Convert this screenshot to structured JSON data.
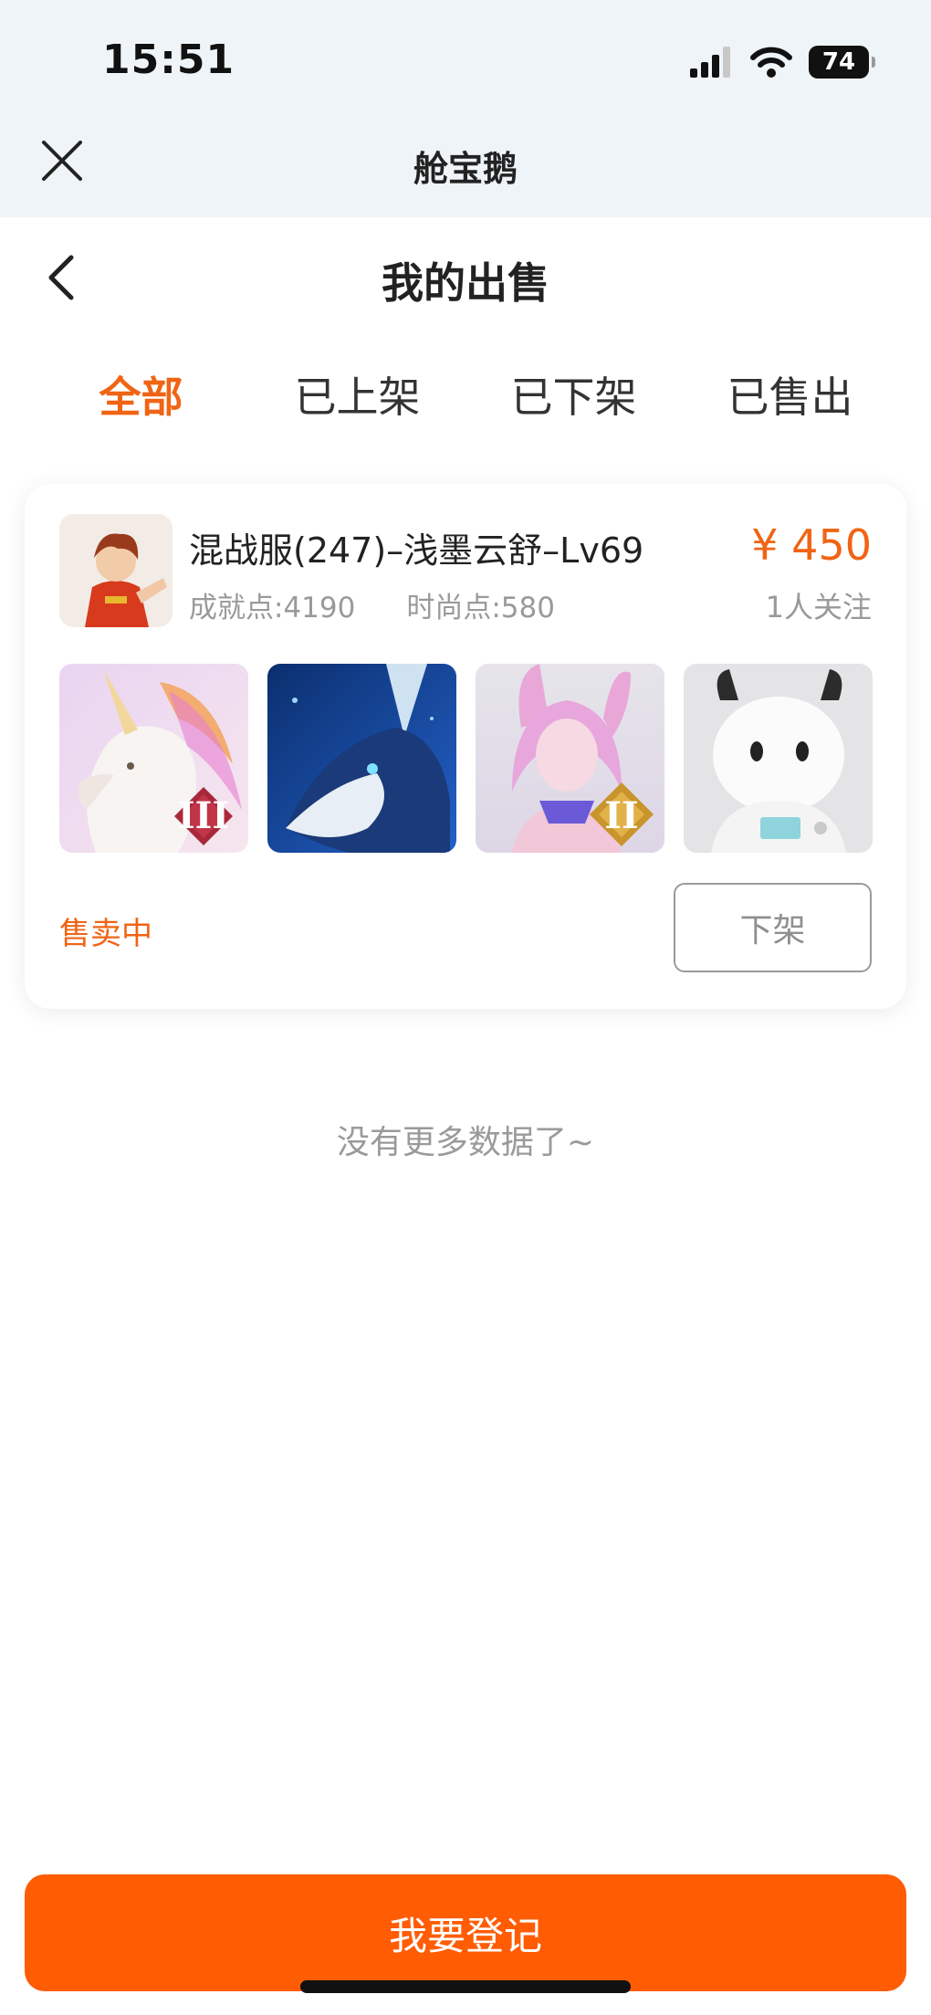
{
  "status_bar": {
    "time": "15:51",
    "battery": "74",
    "icons": [
      "signal-icon",
      "wifi-icon",
      "battery-icon"
    ]
  },
  "app_bar": {
    "title": "舱宝鹅",
    "close_icon": "close-icon"
  },
  "header": {
    "title": "我的出售",
    "back_icon": "chevron-left-icon"
  },
  "tabs": [
    {
      "label": "全部",
      "active": true
    },
    {
      "label": "已上架",
      "active": false
    },
    {
      "label": "已下架",
      "active": false
    },
    {
      "label": "已售出",
      "active": false
    }
  ],
  "listing": {
    "title": "混战服(247)–浅墨云舒–Lv69",
    "achievement": "成就点:4190",
    "fashion": "时尚点:580",
    "price": "¥ 450",
    "followers": "1人关注",
    "thumbnails": [
      {
        "name": "unicorn-mount-thumbnail",
        "badge": "III"
      },
      {
        "name": "blue-fox-mount-thumbnail",
        "badge": ""
      },
      {
        "name": "fox-spirit-costume-thumbnail",
        "badge": "II"
      },
      {
        "name": "white-cow-pet-thumbnail",
        "badge": ""
      }
    ],
    "status": "售卖中",
    "delist_label": "下架"
  },
  "footer_note": "没有更多数据了~",
  "register_button": "我要登记",
  "colors": {
    "accent": "#f06414",
    "button": "#ff5c04",
    "top_bar": "#eef4f7"
  }
}
